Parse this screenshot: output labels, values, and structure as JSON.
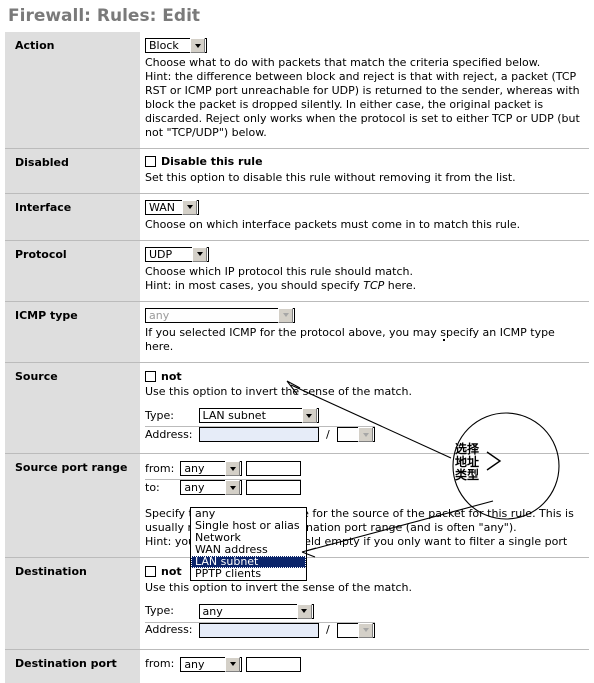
{
  "page": {
    "title": "Firewall: Rules: Edit"
  },
  "rows": {
    "action": {
      "label": "Action",
      "select_value": "Block",
      "desc1": "Choose what to do with packets that match the criteria specified below.",
      "desc2": "Hint: the difference between block and reject is that with reject, a packet (TCP RST or ICMP port unreachable for UDP) is returned to the sender, whereas with block the packet is dropped silently. In either case, the original packet is discarded. Reject only works when the protocol is set to either TCP or UDP (but not \"TCP/UDP\") below."
    },
    "disabled": {
      "label": "Disabled",
      "checkbox_label": "Disable this rule",
      "desc": "Set this option to disable this rule without removing it from the list."
    },
    "interface": {
      "label": "Interface",
      "select_value": "WAN",
      "desc": "Choose on which interface packets must come in to match this rule."
    },
    "protocol": {
      "label": "Protocol",
      "select_value": "UDP",
      "desc1": "Choose which IP protocol this rule should match.",
      "desc2_pre": "Hint: in most cases, you should specify ",
      "desc2_em": "TCP",
      "desc2_post": " here."
    },
    "icmp": {
      "label": "ICMP type",
      "select_value": "any",
      "desc": "If you selected ICMP for the protocol above, you may specify an ICMP type here."
    },
    "source": {
      "label": "Source",
      "not_label": "not",
      "not_desc": "Use this option to invert the sense of the match.",
      "type_label": "Type:",
      "type_value": "LAN subnet",
      "address_label": "Address:",
      "address_value": "",
      "mask_value": ""
    },
    "source_port": {
      "label": "Source port range",
      "from_label": "from:",
      "from_value": "any",
      "from_custom": "",
      "to_label": "to:",
      "to_value": "any",
      "to_custom": "",
      "desc1": "Specify the port or port range for the source of the packet for this rule. This is usually not equal to the destination port range (and is often \"any\").",
      "desc2": "Hint: you can leave the 'to' field empty if you only want to filter a single port"
    },
    "destination": {
      "label": "Destination",
      "not_label": "not",
      "not_desc": "Use this option to invert the sense of the match.",
      "type_label": "Type:",
      "type_value": "any",
      "address_label": "Address:",
      "address_value": "",
      "mask_value": ""
    },
    "destination_port": {
      "label": "Destination port",
      "from_label": "from:",
      "from_value": "any",
      "from_custom": ""
    }
  },
  "open_dropdown": {
    "options": [
      "any",
      "Single host or alias",
      "Network",
      "WAN address",
      "LAN subnet",
      "PPTP clients"
    ],
    "selected": "LAN subnet"
  },
  "annotation": {
    "line1": "选择",
    "line2": "地址",
    "line3": "类型",
    "ink_color": "#000000"
  }
}
